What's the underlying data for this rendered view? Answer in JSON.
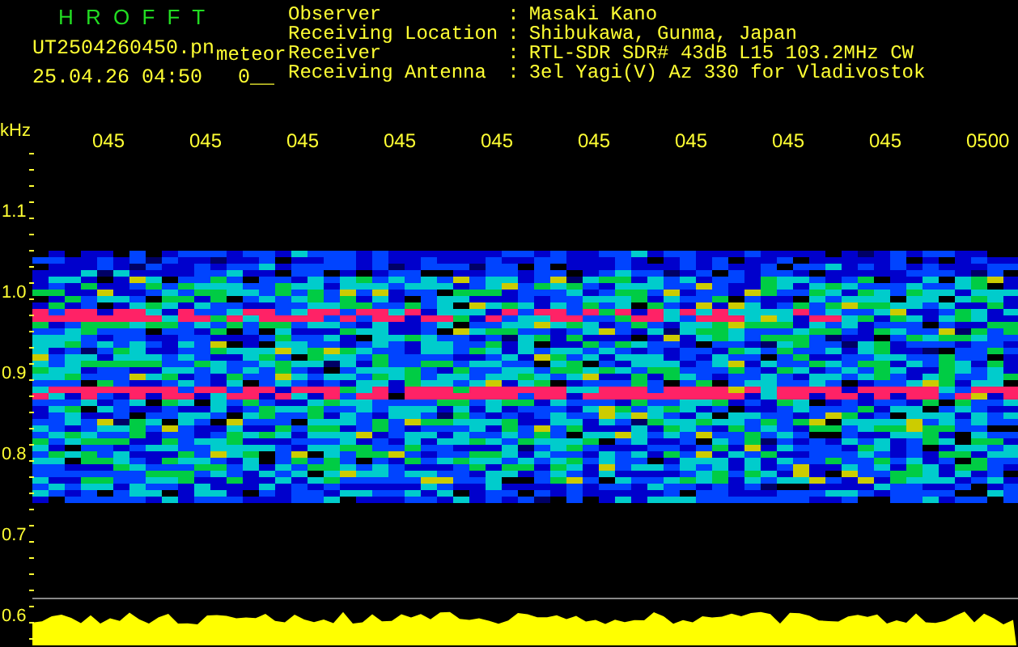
{
  "header": {
    "title": "H R O F F T",
    "file_name": "UT2504260450.pn",
    "mode": "meteor",
    "datetime": "25.04.26 04:50",
    "counter": "0__"
  },
  "station": [
    {
      "label": "Observer",
      "separator": ":",
      "value": "Masaki Kano"
    },
    {
      "label": "Receiving Location",
      "separator": ":",
      "value": "Shibukawa, Gunma, Japan"
    },
    {
      "label": "Receiver",
      "separator": ":",
      "value": "RTL-SDR SDR# 43dB L15 103.2MHz CW"
    },
    {
      "label": "Receiving Antenna",
      "separator": ":",
      "value": "3el Yagi(V) Az 330 for Vladivostok"
    }
  ],
  "plot": {
    "freq_unit": "kHz",
    "time_labels": [
      "045",
      "045",
      "045",
      "045",
      "045",
      "045",
      "045",
      "045",
      "045",
      "0500"
    ],
    "freq_labels": [
      "1.1",
      "1.0",
      "0.9",
      "0.8",
      "0.7",
      "0.6"
    ]
  }
}
